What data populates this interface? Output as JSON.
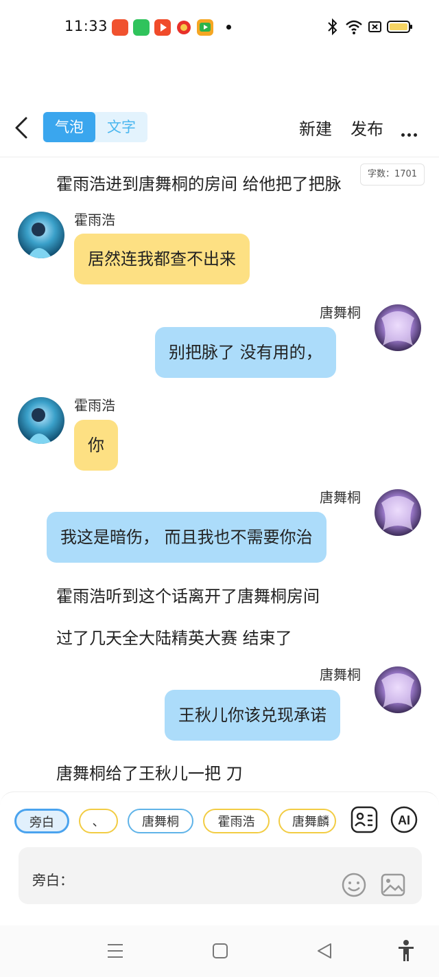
{
  "status_bar": {
    "time": "11:33",
    "app_icons": [
      "app-icon-1",
      "app-icon-2",
      "app-icon-3",
      "app-icon-4",
      "app-icon-5"
    ],
    "battery_color": "#f5d463"
  },
  "header": {
    "tabs": [
      "气泡",
      "文字"
    ],
    "active_tab": "气泡",
    "new_label": "新建",
    "publish_label": "发布"
  },
  "word_count": "字数：1701",
  "story": {
    "line1": "霍雨浩进到唐舞桐的房间 给他把了把脉",
    "msg1": {
      "speaker": "霍雨浩",
      "text": "居然连我都查不出来",
      "side": "left"
    },
    "msg2": {
      "speaker": "唐舞桐",
      "text": "别把脉了 没有用的，",
      "side": "right"
    },
    "msg3": {
      "speaker": "霍雨浩",
      "text": "你",
      "side": "left"
    },
    "msg4": {
      "speaker": "唐舞桐",
      "text": "我这是暗伤， 而且我也不需要你治",
      "side": "right"
    },
    "line2": "霍雨浩听到这个话离开了唐舞桐房间",
    "line3": "过了几天全大陆精英大赛 结束了",
    "msg5": {
      "speaker": "唐舞桐",
      "text": "王秋儿你该兑现承诺",
      "side": "right"
    },
    "line4": "唐舞桐给了王秋儿一把 刀"
  },
  "roles": [
    "旁白",
    "、",
    "唐舞桐",
    "霍雨浩",
    "唐舞麟"
  ],
  "input": {
    "label": "旁白："
  },
  "colors": {
    "accent": "#3aa6ee",
    "left_bubble": "#fde083",
    "right_bubble": "#acdcfa"
  }
}
